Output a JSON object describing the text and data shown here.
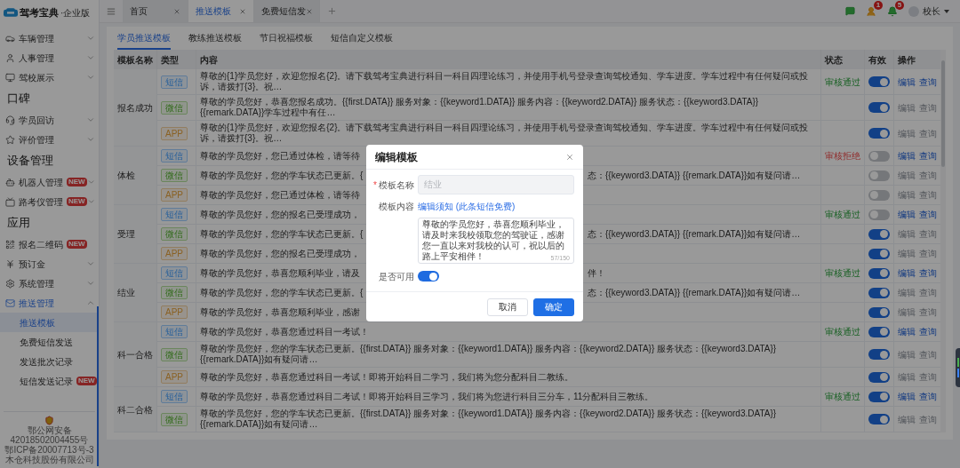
{
  "logo": {
    "name": "驾考宝典",
    "edition": "·企业版"
  },
  "sidebar": {
    "sections": [
      {
        "items": [
          {
            "label": "车辆管理",
            "expanded": false,
            "selected": false
          },
          {
            "label": "人事管理",
            "expanded": false,
            "selected": false
          },
          {
            "label": "驾校展示",
            "expanded": false,
            "selected": false
          }
        ]
      },
      {
        "title": "口碑",
        "items": [
          {
            "label": "学员回访",
            "expanded": false,
            "selected": false
          },
          {
            "label": "评价管理",
            "expanded": false,
            "selected": false
          }
        ]
      },
      {
        "title": "设备管理",
        "items": [
          {
            "label": "机器人管理",
            "badge": "NEW",
            "expanded": false,
            "selected": false
          },
          {
            "label": "路考仪管理",
            "badge": "NEW",
            "expanded": false,
            "selected": false
          }
        ]
      },
      {
        "title": "应用",
        "items": [
          {
            "label": "报名二维码",
            "badge": "NEW",
            "selected": false
          },
          {
            "label": "预订金",
            "expanded": false,
            "selected": false
          },
          {
            "label": "系统管理",
            "expanded": false,
            "selected": false
          },
          {
            "label": "推送管理",
            "expanded": true,
            "selected": true,
            "children": [
              {
                "label": "推送模板",
                "selected": true
              },
              {
                "label": "免费短信发送",
                "selected": false
              },
              {
                "label": "发送批次记录",
                "selected": false
              },
              {
                "label": "短信发送记录",
                "badge": "NEW",
                "selected": false
              }
            ]
          }
        ]
      }
    ]
  },
  "footer": {
    "lines": [
      "鄂公网安备 42018502004455号",
      "鄂ICP备20007713号-3",
      "木仓科技股份有限公司"
    ]
  },
  "tabs": [
    {
      "label": "首页",
      "selected": false
    },
    {
      "label": "推送模板",
      "selected": true
    },
    {
      "label": "免费短信发",
      "selected": false
    }
  ],
  "header": {
    "notifications": [
      {
        "kind": "user",
        "count": "1"
      },
      {
        "kind": "bell",
        "count": "5"
      }
    ],
    "user": "校长"
  },
  "subtabs": [
    {
      "label": "学员推送模板",
      "selected": true
    },
    {
      "label": "教练推送模板",
      "selected": false
    },
    {
      "label": "节日祝福模板",
      "selected": false
    },
    {
      "label": "短信自定义模板",
      "selected": false
    }
  ],
  "table": {
    "columns": [
      "模板名称",
      "类型",
      "内容",
      "状态",
      "有效",
      "操作"
    ],
    "groups": [
      {
        "name": "报名成功",
        "rows": [
          {
            "type": "短信",
            "kind": "sms",
            "content": "尊敬的{1}学员您好，欢迎您报名{2}。请下载驾考宝典进行科目一科目四理论练习，并使用手机号登录查询驾校通知、学车进度。学车过程中有任何疑问或投诉，请拨打{3}。祝…",
            "status": {
              "text": "审核通过",
              "kind": "approved"
            },
            "enabled": true,
            "actions": [
              {
                "label": "编辑",
                "disabled": false
              },
              {
                "label": "查询",
                "disabled": false
              }
            ]
          },
          {
            "type": "微信",
            "kind": "wechat",
            "content": "尊敬的学员您好，恭喜您报名成功。{{first.DATA}} 服务对象：{{keyword1.DATA}} 服务内容：{{keyword2.DATA}} 服务状态：{{keyword3.DATA}} {{remark.DATA}}学车过程中有任…",
            "enabled": true,
            "actions": [
              {
                "label": "编辑",
                "disabled": true
              },
              {
                "label": "查询",
                "disabled": true
              }
            ]
          },
          {
            "type": "APP",
            "kind": "app",
            "content": "尊敬的{1}学员您好，欢迎您报名{2}。请下载驾考宝典进行科目一科目四理论练习，并使用手机号登录查询驾校通知、学车进度。学车过程中有任何疑问或投诉，请拨打{3}。祝…",
            "enabled": true,
            "actions": [
              {
                "label": "编辑",
                "disabled": true
              },
              {
                "label": "查询",
                "disabled": true
              }
            ]
          }
        ]
      },
      {
        "name": "体检",
        "rows": [
          {
            "type": "短信",
            "kind": "sms",
            "content": "尊敬的学员您好，您已通过体检，请等待",
            "status": {
              "text": "审核拒绝",
              "kind": "rejected"
            },
            "enabled": false,
            "actions": [
              {
                "label": "编辑",
                "disabled": false
              },
              {
                "label": "查询",
                "disabled": false
              }
            ]
          },
          {
            "type": "微信",
            "kind": "wechat",
            "content": "尊敬的学员您好，您的学车状态已更新。{",
            "content_after": "态：{{keyword3.DATA}} {{remark.DATA}}如有疑问请…",
            "enabled": false,
            "actions": [
              {
                "label": "编辑",
                "disabled": true
              },
              {
                "label": "查询",
                "disabled": true
              }
            ]
          },
          {
            "type": "APP",
            "kind": "app",
            "content": "尊敬的学员您好，您已通过体检，请等待",
            "enabled": false,
            "actions": [
              {
                "label": "编辑",
                "disabled": true
              },
              {
                "label": "查询",
                "disabled": true
              }
            ]
          }
        ]
      },
      {
        "name": "受理",
        "rows": [
          {
            "type": "短信",
            "kind": "sms",
            "content": "尊敬的学员您好，您的报名已受理成功，",
            "status": {
              "text": "审核通过",
              "kind": "approved"
            },
            "enabled": false,
            "actions": [
              {
                "label": "编辑",
                "disabled": false
              },
              {
                "label": "查询",
                "disabled": false
              }
            ]
          },
          {
            "type": "微信",
            "kind": "wechat",
            "content": "尊敬的学员您好，您的学车状态已更新。{",
            "content_after": "态：{{keyword3.DATA}} {{remark.DATA}}如有疑问请…",
            "enabled": true,
            "actions": [
              {
                "label": "编辑",
                "disabled": true
              },
              {
                "label": "查询",
                "disabled": true
              }
            ]
          },
          {
            "type": "APP",
            "kind": "app",
            "content": "尊敬的学员您好，您的报名已受理成功，",
            "enabled": true,
            "actions": [
              {
                "label": "编辑",
                "disabled": true
              },
              {
                "label": "查询",
                "disabled": true
              }
            ]
          }
        ]
      },
      {
        "name": "结业",
        "rows": [
          {
            "type": "短信",
            "kind": "sms",
            "content": "尊敬的学员您好，恭喜您顺利毕业，请及",
            "content_after": "伴！",
            "status": {
              "text": "审核通过",
              "kind": "approved"
            },
            "enabled": true,
            "actions": [
              {
                "label": "编辑",
                "disabled": false
              },
              {
                "label": "查询",
                "disabled": false
              }
            ]
          },
          {
            "type": "微信",
            "kind": "wechat",
            "content": "尊敬的学员您好，您的学车状态已更新。{",
            "content_after": "态：{{keyword3.DATA}} {{remark.DATA}}如有疑问请…",
            "enabled": true,
            "actions": [
              {
                "label": "编辑",
                "disabled": true
              },
              {
                "label": "查询",
                "disabled": true
              }
            ]
          },
          {
            "type": "APP",
            "kind": "app",
            "content": "尊敬的学员您好，恭喜您顺利毕业，感谢",
            "enabled": true,
            "actions": [
              {
                "label": "编辑",
                "disabled": true
              },
              {
                "label": "查询",
                "disabled": true
              }
            ]
          }
        ]
      },
      {
        "name": "科一合格",
        "rows": [
          {
            "type": "短信",
            "kind": "sms",
            "content": "尊敬的学员您好，恭喜您通过科目一考试！",
            "status": {
              "text": "审核通过",
              "kind": "approved"
            },
            "enabled": true,
            "actions": [
              {
                "label": "编辑",
                "disabled": false
              },
              {
                "label": "查询",
                "disabled": false
              }
            ]
          },
          {
            "type": "微信",
            "kind": "wechat",
            "content": "尊敬的学员您好，您的学车状态已更新。{{first.DATA}} 服务对象：{{keyword1.DATA}} 服务内容：{{keyword2.DATA}} 服务状态：{{keyword3.DATA}} {{remark.DATA}}如有疑问请…",
            "enabled": true,
            "actions": [
              {
                "label": "编辑",
                "disabled": true
              },
              {
                "label": "查询",
                "disabled": true
              }
            ]
          },
          {
            "type": "APP",
            "kind": "app",
            "content": "尊敬的学员您好，恭喜您通过科目一考试！即将开始科目二学习，我们将为您分配科目二教练。",
            "enabled": true,
            "actions": [
              {
                "label": "编辑",
                "disabled": true
              },
              {
                "label": "查询",
                "disabled": true
              }
            ]
          }
        ]
      },
      {
        "name": "科二合格",
        "rows": [
          {
            "type": "短信",
            "kind": "sms",
            "content": "尊敬的学员您好，恭喜您通过科目二考试！即将开始科目三学习，我们将为您进行科目三分车，11分配科目三教练。",
            "status": {
              "text": "审核通过",
              "kind": "approved"
            },
            "enabled": true,
            "actions": [
              {
                "label": "编辑",
                "disabled": false
              },
              {
                "label": "查询",
                "disabled": false
              }
            ]
          },
          {
            "type": "微信",
            "kind": "wechat",
            "content": "尊敬的学员您好，您的学车状态已更新。{{first.DATA}} 服务对象：{{keyword1.DATA}} 服务内容：{{keyword2.DATA}} 服务状态：{{keyword3.DATA}} {{remark.DATA}}如有疑问请…",
            "enabled": true,
            "actions": [
              {
                "label": "编辑",
                "disabled": true
              },
              {
                "label": "查询",
                "disabled": true
              }
            ]
          }
        ]
      }
    ]
  },
  "modal": {
    "title": "编辑模板",
    "fields": [
      {
        "kind": "input",
        "label": "模板名称",
        "required_mark": "*",
        "value": "结业",
        "disabled": true
      },
      {
        "kind": "link",
        "label": "模板内容",
        "link": "编辑须知 (此条短信免费)"
      },
      {
        "kind": "textarea",
        "value": "尊敬的学员您好，恭喜您顺利毕业，请及时来我校领取您的驾驶证，感谢您一直以来对我校的认可，祝以后的路上平安相伴！",
        "counter": "57/150"
      },
      {
        "kind": "switch",
        "label": "是否可用",
        "on": true
      }
    ],
    "buttons": [
      {
        "label": "取消",
        "kind": "secondary"
      },
      {
        "label": "确定",
        "kind": "primary"
      }
    ]
  }
}
